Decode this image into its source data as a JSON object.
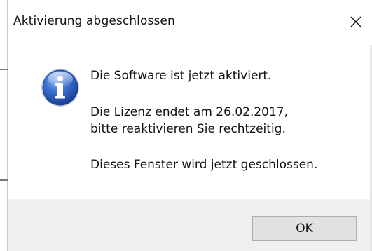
{
  "window": {
    "title": "Aktivierung abgeschlossen"
  },
  "icons": {
    "info": "info-icon",
    "close": "close-icon"
  },
  "message": {
    "line1": "Die Software ist jetzt aktiviert.",
    "line2": "Die Lizenz endet am 26.02.2017,",
    "line3": "bitte reaktivieren Sie rechtzeitig.",
    "line4": "Dieses Fenster wird jetzt geschlossen."
  },
  "buttons": {
    "ok_label": "OK"
  },
  "colors": {
    "footer_bg": "#f0f0f0",
    "button_bg": "#e1e1e1",
    "icon_blue": "#2f64c0"
  }
}
